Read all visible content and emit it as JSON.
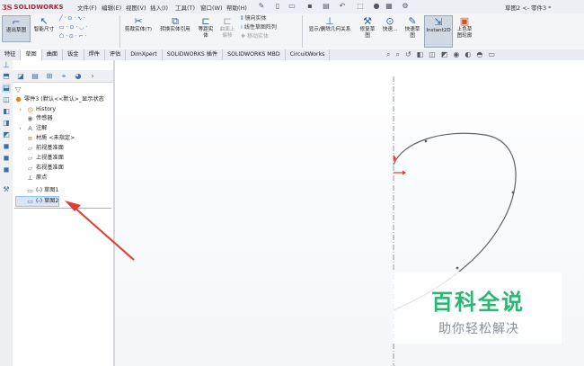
{
  "app": {
    "logo_prefix": "3S",
    "logo_text": "SOLIDWORKS",
    "document_title": "草图2 <- 零件3 *"
  },
  "menu": [
    "文件(F)",
    "编辑(E)",
    "视图(V)",
    "插入(I)",
    "工具(T)",
    "窗口(W)",
    "帮助(H)"
  ],
  "ribbon": {
    "exit_sketch": "退出草图",
    "smart_dimension": "智能尺寸",
    "cut_solid": "剪裁实体(T)",
    "convert_entities": "转换实体引用",
    "offset_entities": "等距实体",
    "offset_on_surface_1": "曲面上",
    "offset_on_surface_2": "偏移",
    "mirror_entities": "镜向实体",
    "linear_pattern": "线性草图阵列",
    "move_entities": "移动实体",
    "display_relations": "显示/删除几何关系",
    "repair_sketch_1": "修复草",
    "repair_sketch_2": "图",
    "quick_snaps_1": "快速...",
    "rapid_sketch_1": "快速草",
    "rapid_sketch_2": "图",
    "instant2d": "Instant2D",
    "shaded_sketch_1": "上色草",
    "shaded_sketch_2": "图轮廓"
  },
  "tabs": [
    "特征",
    "草图",
    "曲面",
    "钣金",
    "焊件",
    "评估",
    "DimXpert",
    "SOLIDWORKS 插件",
    "SOLIDWORKS MBD",
    "CircuitWorks"
  ],
  "active_tab": "草图",
  "tree": {
    "part": "零件3 (默认<<默认>_显示状态",
    "items": [
      "History",
      "传感器",
      "注解",
      "材质 <未指定>",
      "前视基准面",
      "上视基准面",
      "右视基准面",
      "原点",
      "(-) 草图1",
      "(-) 草图2"
    ]
  },
  "watermark": {
    "title": "百科全说",
    "subtitle": "助你轻松解决"
  },
  "colors": {
    "accent": "#2d5f9a",
    "watermark_green": "#2bb673",
    "arrow_red": "#e53935",
    "selection_blue": "#d6e6f7"
  }
}
